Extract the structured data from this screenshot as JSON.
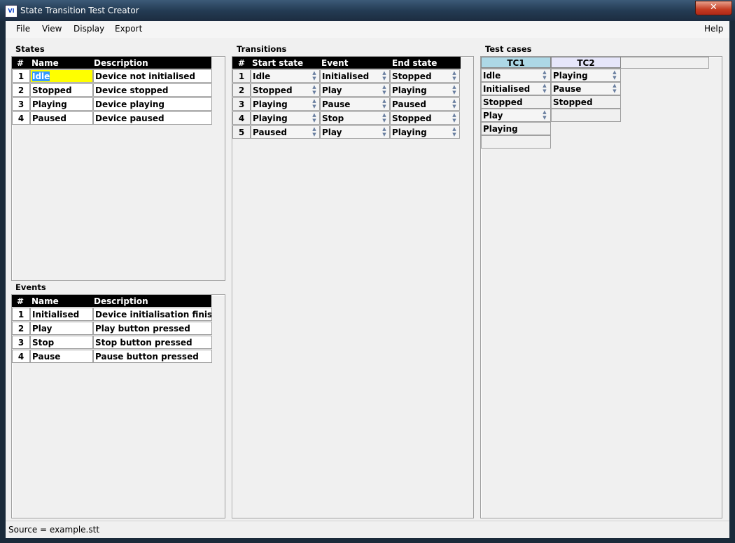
{
  "window": {
    "title": "State Transition Test Creator",
    "close_label": "✕",
    "app_icon_label": "VI"
  },
  "menu": [
    "File",
    "View",
    "Display",
    "Export",
    "Help"
  ],
  "states": {
    "label": "States",
    "columns": [
      "#",
      "Name",
      "Description"
    ],
    "rows": [
      {
        "num": "1",
        "name": "Idle",
        "desc": "Device not initialised"
      },
      {
        "num": "2",
        "name": "Stopped",
        "desc": "Device stopped"
      },
      {
        "num": "3",
        "name": "Playing",
        "desc": "Device playing"
      },
      {
        "num": "4",
        "name": "Paused",
        "desc": "Device paused"
      }
    ]
  },
  "events": {
    "label": "Events",
    "columns": [
      "#",
      "Name",
      "Description"
    ],
    "rows": [
      {
        "num": "1",
        "name": "Initialised",
        "desc": "Device initialisation finished"
      },
      {
        "num": "2",
        "name": "Play",
        "desc": "Play button pressed"
      },
      {
        "num": "3",
        "name": "Stop",
        "desc": "Stop button pressed"
      },
      {
        "num": "4",
        "name": "Pause",
        "desc": "Pause button pressed"
      }
    ]
  },
  "transitions": {
    "label": "Transitions",
    "columns": [
      "#",
      "Start state",
      "Event",
      "End state"
    ],
    "rows": [
      {
        "num": "1",
        "start": "Idle",
        "event": "Initialised",
        "end": "Stopped"
      },
      {
        "num": "2",
        "start": "Stopped",
        "event": "Play",
        "end": "Playing"
      },
      {
        "num": "3",
        "start": "Playing",
        "event": "Pause",
        "end": "Paused"
      },
      {
        "num": "4",
        "start": "Playing",
        "event": "Stop",
        "end": "Stopped"
      },
      {
        "num": "5",
        "start": "Paused",
        "event": "Play",
        "end": "Playing"
      }
    ]
  },
  "test_cases": {
    "label": "Test cases",
    "tabs": [
      {
        "name": "TC1",
        "color": "#add8e6"
      },
      {
        "name": "TC2",
        "color": "#e6e6fa"
      }
    ],
    "tc1": [
      "Idle",
      "Initialised",
      "Stopped",
      "Play",
      "Playing"
    ],
    "tc2": [
      "Playing",
      "Pause",
      "Stopped"
    ]
  },
  "status": "Source = example.stt",
  "colors": {
    "selected_cell": "#ffff00",
    "selection_highlight": "#3399ff"
  }
}
